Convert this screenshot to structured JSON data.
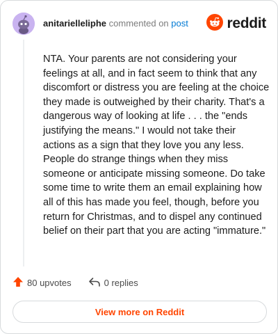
{
  "comment": {
    "username": "anitarielleliphe",
    "commented_on": "commented on",
    "post_link": "post",
    "body": "NTA. Your parents are not considering your feelings at all, and in fact seem to think that any discomfort or distress you are feeling at the choice they made is outweighed by their charity. That's a dangerous way of looking at life . . . the \"ends justifying the means.\" I would not take their actions as a sign that they love you any less. People do strange things when they miss someone or anticipate missing someone. Do take some time to write them an email explaining how all of this has made you feel, though, before you return for Christmas, and to dispel any continued belief on their part that you are acting \"immature.\""
  },
  "brand": {
    "wordmark": "reddit",
    "accent_color": "#ff4500"
  },
  "actions": {
    "upvotes": "80 upvotes",
    "replies": "0 replies"
  },
  "footer": {
    "view_more": "View more on Reddit"
  },
  "icons": {
    "avatar": "snoo-avatar-icon",
    "brand": "reddit-logo-icon",
    "upvote": "upvote-arrow-icon",
    "reply": "reply-arrow-icon"
  }
}
